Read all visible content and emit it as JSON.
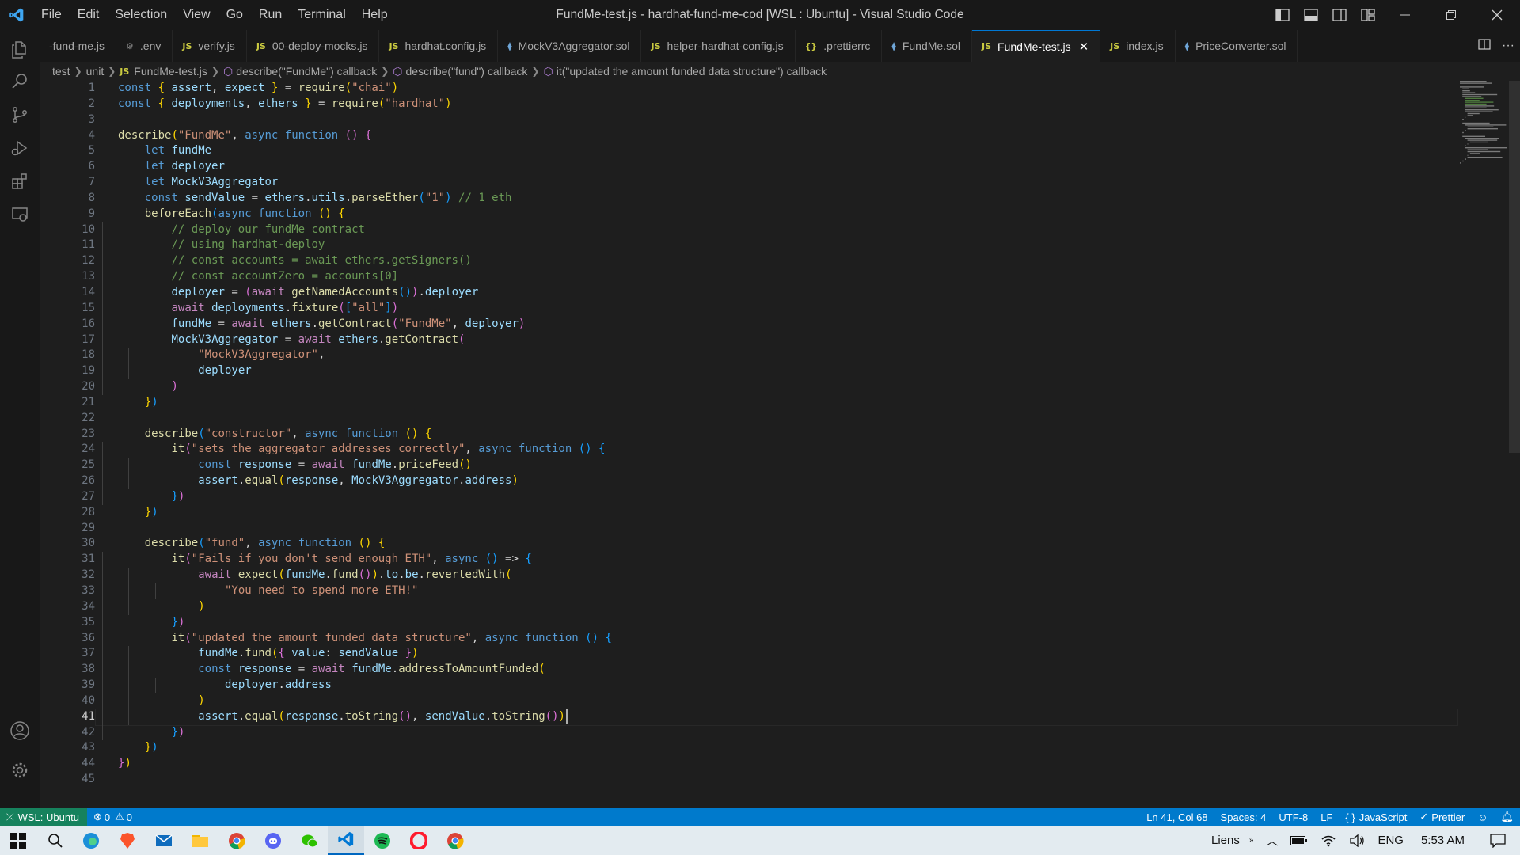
{
  "window": {
    "title": "FundMe-test.js - hardhat-fund-me-cod [WSL : Ubuntu] - Visual Studio Code",
    "menu": [
      "File",
      "Edit",
      "Selection",
      "View",
      "Go",
      "Run",
      "Terminal",
      "Help"
    ]
  },
  "tabs": [
    {
      "label": "-fund-me.js",
      "icon": "",
      "active": false
    },
    {
      "label": ".env",
      "icon": "gear-icon",
      "active": false
    },
    {
      "label": "verify.js",
      "icon": "js-icon",
      "active": false
    },
    {
      "label": "00-deploy-mocks.js",
      "icon": "js-icon",
      "active": false
    },
    {
      "label": "hardhat.config.js",
      "icon": "js-icon",
      "active": false
    },
    {
      "label": "MockV3Aggregator.sol",
      "icon": "solidity-icon",
      "active": false
    },
    {
      "label": "helper-hardhat-config.js",
      "icon": "js-icon",
      "active": false
    },
    {
      "label": ".prettierrc",
      "icon": "json-icon",
      "active": false
    },
    {
      "label": "FundMe.sol",
      "icon": "solidity-icon",
      "active": false
    },
    {
      "label": "FundMe-test.js",
      "icon": "js-icon",
      "active": true
    },
    {
      "label": "index.js",
      "icon": "js-icon",
      "active": false
    },
    {
      "label": "PriceConverter.sol",
      "icon": "solidity-icon",
      "active": false
    }
  ],
  "file_icon_text": {
    "js": "JS",
    "json": "{}"
  },
  "breadcrumb": [
    "test",
    "unit",
    "FundMe-test.js",
    "describe(\"FundMe\") callback",
    "describe(\"fund\") callback",
    "it(\"updated the amount funded data structure\") callback"
  ],
  "editor": {
    "current_line": 41,
    "lines": [
      "const { assert, expect } = require(\"chai\")",
      "const { deployments, ethers } = require(\"hardhat\")",
      "",
      "describe(\"FundMe\", async function () {",
      "    let fundMe",
      "    let deployer",
      "    let MockV3Aggregator",
      "    const sendValue = ethers.utils.parseEther(\"1\") // 1 eth",
      "    beforeEach(async function () {",
      "        // deploy our fundMe contract",
      "        // using hardhat-deploy",
      "        // const accounts = await ethers.getSigners()",
      "        // const accountZero = accounts[0]",
      "        deployer = (await getNamedAccounts()).deployer",
      "        await deployments.fixture([\"all\"])",
      "        fundMe = await ethers.getContract(\"FundMe\", deployer)",
      "        MockV3Aggregator = await ethers.getContract(",
      "            \"MockV3Aggregator\",",
      "            deployer",
      "        )",
      "    })",
      "",
      "    describe(\"constructor\", async function () {",
      "        it(\"sets the aggregator addresses correctly\", async function () {",
      "            const response = await fundMe.priceFeed()",
      "            assert.equal(response, MockV3Aggregator.address)",
      "        })",
      "    })",
      "",
      "    describe(\"fund\", async function () {",
      "        it(\"Fails if you don't send enough ETH\", async () => {",
      "            await expect(fundMe.fund()).to.be.revertedWith(",
      "                \"You need to spend more ETH!\"",
      "            )",
      "        })",
      "        it(\"updated the amount funded data structure\", async function () {",
      "            fundMe.fund({ value: sendValue })",
      "            const response = await fundMe.addressToAmountFunded(",
      "                deployer.address",
      "            )",
      "            assert.equal(response.toString(), sendValue.toString())",
      "        })",
      "    })",
      "})",
      ""
    ]
  },
  "statusbar": {
    "remote": "WSL: Ubuntu",
    "errors": "0",
    "warnings": "0",
    "position": "Ln 41, Col 68",
    "spaces": "Spaces: 4",
    "encoding": "UTF-8",
    "eol": "LF",
    "language": "JavaScript",
    "formatter": "Prettier",
    "colors": {
      "bar": "#007acc",
      "remote": "#16825d"
    }
  },
  "taskbar": {
    "links_label": "Liens",
    "language": "ENG",
    "time": "5:53 AM",
    "apps": [
      "windows-start-icon",
      "search-icon",
      "edge-icon",
      "brave-icon",
      "mail-icon",
      "file-explorer-icon",
      "chrome-icon",
      "discord-icon",
      "wechat-icon",
      "vscode-icon",
      "spotify-icon",
      "opera-icon",
      "chrome-icon"
    ]
  }
}
